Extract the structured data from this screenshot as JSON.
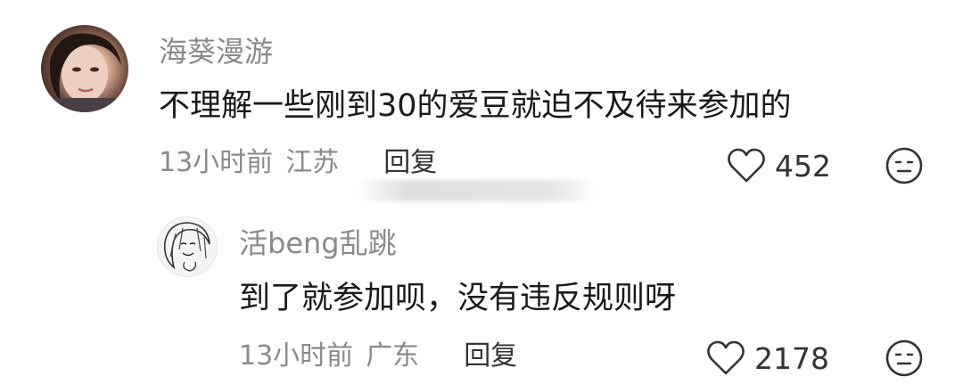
{
  "comments": [
    {
      "username": "海葵漫游",
      "content": "不理解一些刚到30的爱豆就迫不及待来参加的",
      "time": "13小时前",
      "location": "江苏",
      "reply_label": "回复",
      "likes": "452",
      "like_icon": "heart-outline-icon",
      "dislike_icon": "meh-face-icon"
    },
    {
      "username": "活beng乱跳",
      "content": "到了就参加呗，没有违反规则呀",
      "time": "13小时前",
      "location": "广东",
      "reply_label": "回复",
      "likes": "2178",
      "like_icon": "heart-outline-icon",
      "dislike_icon": "meh-face-icon"
    }
  ],
  "colors": {
    "username": "#8a8a8a",
    "content": "#1a1a1a",
    "meta": "#8a8a8a"
  }
}
